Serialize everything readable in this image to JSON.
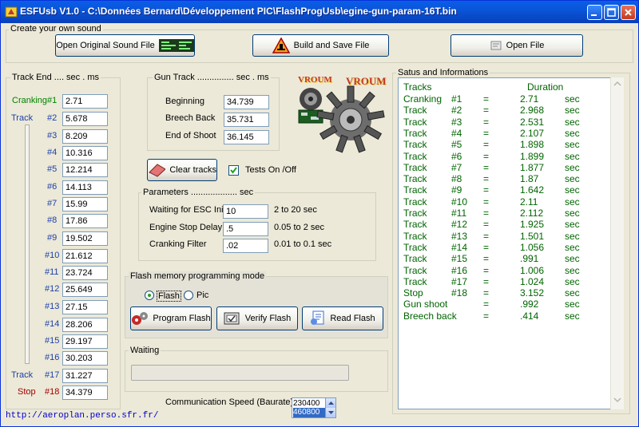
{
  "window": {
    "title": "ESFUsb V1.0  -  C:\\Données Bernard\\Développement PIC\\FlashProgUsb\\egine-gun-param-16T.bin"
  },
  "create_group": {
    "label": "Create your own sound",
    "open_original_label": "Open Original  Sound File",
    "build_save_label": "Build and Save  File",
    "open_file_label": "Open  File"
  },
  "track_end": {
    "label": "Track End  ....  sec . ms",
    "rows": [
      {
        "name": "Cranking",
        "num": "#1",
        "value": "2.71",
        "color": "#008000"
      },
      {
        "name": "Track",
        "num": "#2",
        "value": "5.678",
        "color": "#1c3fa8"
      },
      {
        "name": "",
        "num": "#3",
        "value": "8.209",
        "color": "#1c3fa8"
      },
      {
        "name": "",
        "num": "#4",
        "value": "10.316",
        "color": "#1c3fa8"
      },
      {
        "name": "",
        "num": "#5",
        "value": "12.214",
        "color": "#1c3fa8"
      },
      {
        "name": "",
        "num": "#6",
        "value": "14.113",
        "color": "#1c3fa8"
      },
      {
        "name": "",
        "num": "#7",
        "value": "15.99",
        "color": "#1c3fa8"
      },
      {
        "name": "",
        "num": "#8",
        "value": "17.86",
        "color": "#1c3fa8"
      },
      {
        "name": "",
        "num": "#9",
        "value": "19.502",
        "color": "#1c3fa8"
      },
      {
        "name": "",
        "num": "#10",
        "value": "21.612",
        "color": "#1c3fa8"
      },
      {
        "name": "",
        "num": "#11",
        "value": "23.724",
        "color": "#1c3fa8"
      },
      {
        "name": "",
        "num": "#12",
        "value": "25.649",
        "color": "#1c3fa8"
      },
      {
        "name": "",
        "num": "#13",
        "value": "27.15",
        "color": "#1c3fa8"
      },
      {
        "name": "",
        "num": "#14",
        "value": "28.206",
        "color": "#1c3fa8"
      },
      {
        "name": "",
        "num": "#15",
        "value": "29.197",
        "color": "#1c3fa8"
      },
      {
        "name": "",
        "num": "#16",
        "value": "30.203",
        "color": "#1c3fa8"
      },
      {
        "name": "Track",
        "num": "#17",
        "value": "31.227",
        "color": "#1c3fa8"
      },
      {
        "name": "Stop",
        "num": "#18",
        "value": "34.379",
        "color": "#a00000"
      }
    ]
  },
  "gun_track": {
    "label": "Gun Track  ...............  sec . ms",
    "beginning_label": "Beginning",
    "beginning_value": "34.739",
    "breech_label": "Breech Back",
    "breech_value": "35.731",
    "end_label": "End of Shoot",
    "end_value": "36.145"
  },
  "clear_tracks_label": "Clear tracks",
  "tests_label": "Tests  On /Off",
  "parameters": {
    "label": "Parameters  ...................  sec",
    "esc_label": "Waiting for ESC Init",
    "esc_value": "10",
    "esc_range": "2 to 20 sec",
    "stop_label": "Engine Stop Delay",
    "stop_value": ".5",
    "stop_range": "0.05 to 2 sec",
    "crank_label": "Cranking Filter",
    "crank_value": ".02",
    "crank_range": "0.01 to 0.1 sec"
  },
  "flash_mode": {
    "label": "Flash memory programming mode",
    "flash_label": "Flash",
    "pic_label": "Pic",
    "program_label": "Program Flash",
    "verify_label": "Verify Flash",
    "read_label": "Read Flash"
  },
  "waiting": {
    "label": "Waiting"
  },
  "comm": {
    "label": "Communication Speed (Baurate)",
    "option1": "230400",
    "option2": "460800"
  },
  "logo": {
    "text1": "VROUM",
    "text2": "VROUM"
  },
  "status_panel": {
    "label": "Satus and Informations",
    "header_left": "Tracks",
    "header_right": "Duration",
    "rows": [
      {
        "name": "Cranking",
        "num": "#1",
        "eq": "=",
        "val": "2.71",
        "unit": "sec"
      },
      {
        "name": "Track",
        "num": "#2",
        "eq": "=",
        "val": "2.968",
        "unit": "sec"
      },
      {
        "name": "Track",
        "num": "#3",
        "eq": "=",
        "val": "2.531",
        "unit": "sec"
      },
      {
        "name": "Track",
        "num": "#4",
        "eq": "=",
        "val": "2.107",
        "unit": "sec"
      },
      {
        "name": "Track",
        "num": "#5",
        "eq": "=",
        "val": "1.898",
        "unit": "sec"
      },
      {
        "name": "Track",
        "num": "#6",
        "eq": "=",
        "val": "1.899",
        "unit": "sec"
      },
      {
        "name": "Track",
        "num": "#7",
        "eq": "=",
        "val": "1.877",
        "unit": "sec"
      },
      {
        "name": "Track",
        "num": "#8",
        "eq": "=",
        "val": "1.87",
        "unit": "sec"
      },
      {
        "name": "Track",
        "num": "#9",
        "eq": "=",
        "val": "1.642",
        "unit": "sec"
      },
      {
        "name": "Track",
        "num": "#10",
        "eq": "=",
        "val": "2.11",
        "unit": "sec"
      },
      {
        "name": "Track",
        "num": "#11",
        "eq": "=",
        "val": "2.112",
        "unit": "sec"
      },
      {
        "name": "Track",
        "num": "#12",
        "eq": "=",
        "val": "1.925",
        "unit": "sec"
      },
      {
        "name": "Track",
        "num": "#13",
        "eq": "=",
        "val": "1.501",
        "unit": "sec"
      },
      {
        "name": "Track",
        "num": "#14",
        "eq": "=",
        "val": "1.056",
        "unit": "sec"
      },
      {
        "name": "Track",
        "num": "#15",
        "eq": "=",
        "val": ".991",
        "unit": "sec"
      },
      {
        "name": "Track",
        "num": "#16",
        "eq": "=",
        "val": "1.006",
        "unit": "sec"
      },
      {
        "name": "Track",
        "num": "#17",
        "eq": "=",
        "val": "1.024",
        "unit": "sec"
      },
      {
        "name": "Stop",
        "num": "#18",
        "eq": "=",
        "val": "3.152",
        "unit": "sec"
      },
      {
        "name": "Gun shoot",
        "num": "",
        "eq": "=",
        "val": ".992",
        "unit": "sec"
      },
      {
        "name": "Breech back",
        "num": "",
        "eq": "=",
        "val": ".414",
        "unit": "sec"
      }
    ]
  },
  "url": "http://aeroplan.perso.sfr.fr/"
}
